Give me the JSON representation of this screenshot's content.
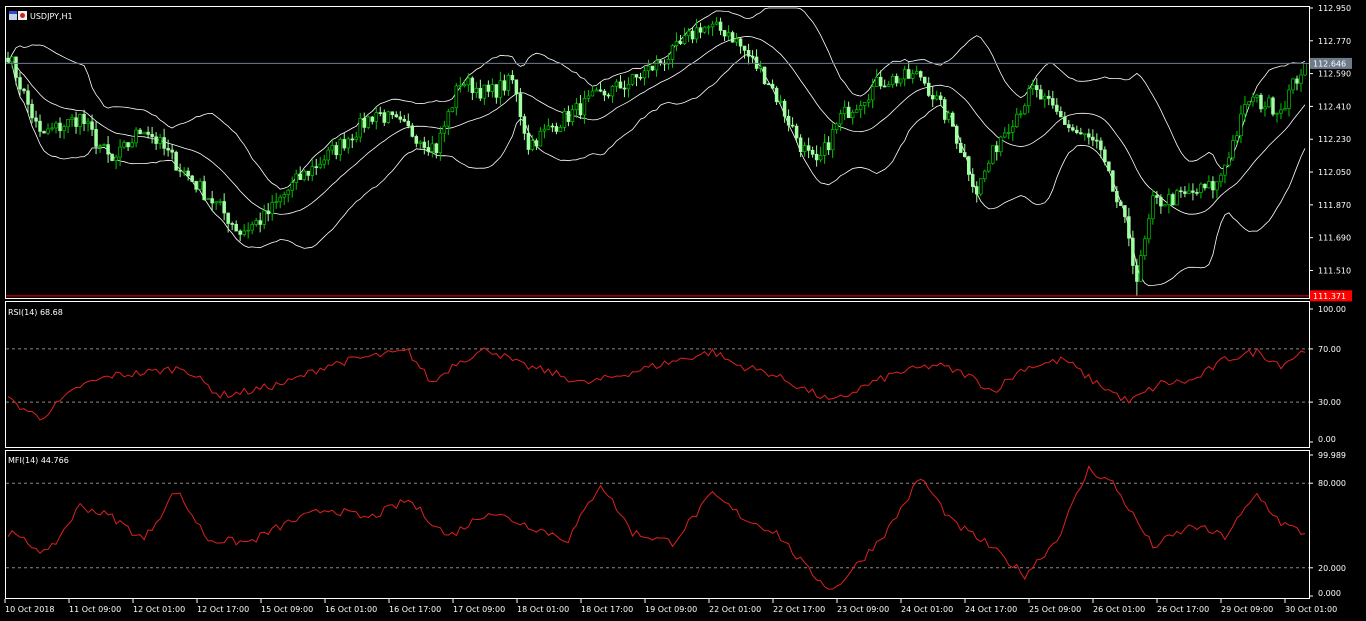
{
  "header": {
    "symbol": "USDJPY,H1",
    "rsi_label": "RSI(14) 68.68",
    "mfi_label": "MFI(14) 44.766"
  },
  "colors": {
    "background": "#000000",
    "frame": "#FFFFFF",
    "bull": "#00C800",
    "bear": "#A0FFA0",
    "bands": "#FFFFFF",
    "indicator": "#FF2020",
    "support_line": "#FF0000",
    "price_tag": "#6E7B8B"
  },
  "chart_data": [
    {
      "type": "candlestick",
      "panel": "main",
      "title": "USDJPY,H1",
      "ylim": [
        111.37,
        112.95
      ],
      "y_ticks": [
        "112.950",
        "112.770",
        "112.590",
        "112.410",
        "112.230",
        "112.050",
        "111.870",
        "111.690",
        "111.510"
      ],
      "last_price": "112.646",
      "support_price": "111.371",
      "overlay": "bollinger",
      "trend_anchors": [
        [
          0,
          112.7
        ],
        [
          8,
          112.25
        ],
        [
          18,
          112.35
        ],
        [
          26,
          112.1
        ],
        [
          34,
          112.3
        ],
        [
          44,
          112.05
        ],
        [
          53,
          111.85
        ],
        [
          58,
          111.72
        ],
        [
          64,
          111.8
        ],
        [
          72,
          112.0
        ],
        [
          82,
          112.18
        ],
        [
          92,
          112.38
        ],
        [
          100,
          112.28
        ],
        [
          107,
          112.18
        ],
        [
          113,
          112.55
        ],
        [
          120,
          112.48
        ],
        [
          126,
          112.55
        ],
        [
          130,
          112.2
        ],
        [
          136,
          112.3
        ],
        [
          146,
          112.45
        ],
        [
          156,
          112.55
        ],
        [
          166,
          112.7
        ],
        [
          173,
          112.85
        ],
        [
          180,
          112.82
        ],
        [
          190,
          112.55
        ],
        [
          198,
          112.2
        ],
        [
          202,
          112.08
        ],
        [
          208,
          112.35
        ],
        [
          218,
          112.55
        ],
        [
          228,
          112.58
        ],
        [
          236,
          112.3
        ],
        [
          242,
          111.95
        ],
        [
          248,
          112.25
        ],
        [
          256,
          112.5
        ],
        [
          266,
          112.28
        ],
        [
          272,
          112.2
        ],
        [
          280,
          111.7
        ],
        [
          282,
          111.45
        ],
        [
          286,
          111.88
        ],
        [
          294,
          111.92
        ],
        [
          302,
          111.98
        ],
        [
          310,
          112.45
        ],
        [
          318,
          112.4
        ],
        [
          324,
          112.65
        ]
      ]
    },
    {
      "type": "line",
      "panel": "rsi",
      "title": "RSI(14) 68.68",
      "ylim": [
        0,
        100
      ],
      "y_ticks": [
        "100.00",
        "70.00",
        "30.00",
        "0.00"
      ],
      "levels": [
        70,
        30
      ],
      "anchors": [
        [
          0,
          32
        ],
        [
          8,
          18
        ],
        [
          18,
          42
        ],
        [
          26,
          50
        ],
        [
          34,
          52
        ],
        [
          44,
          56
        ],
        [
          53,
          35
        ],
        [
          60,
          38
        ],
        [
          70,
          45
        ],
        [
          80,
          58
        ],
        [
          90,
          64
        ],
        [
          100,
          68
        ],
        [
          106,
          44
        ],
        [
          112,
          60
        ],
        [
          120,
          70
        ],
        [
          128,
          58
        ],
        [
          136,
          52
        ],
        [
          144,
          44
        ],
        [
          150,
          48
        ],
        [
          160,
          56
        ],
        [
          168,
          62
        ],
        [
          176,
          68
        ],
        [
          182,
          58
        ],
        [
          190,
          52
        ],
        [
          196,
          44
        ],
        [
          206,
          30
        ],
        [
          214,
          42
        ],
        [
          222,
          52
        ],
        [
          232,
          58
        ],
        [
          240,
          50
        ],
        [
          246,
          38
        ],
        [
          254,
          56
        ],
        [
          264,
          62
        ],
        [
          270,
          48
        ],
        [
          280,
          30
        ],
        [
          288,
          44
        ],
        [
          296,
          46
        ],
        [
          304,
          62
        ],
        [
          312,
          68
        ],
        [
          318,
          58
        ],
        [
          324,
          69
        ]
      ]
    },
    {
      "type": "line",
      "panel": "mfi",
      "title": "MFI(14) 44.766",
      "ylim": [
        0,
        99.989
      ],
      "y_ticks": [
        "99.989",
        "80.000",
        "20.000",
        "0.000"
      ],
      "levels": [
        80,
        20
      ],
      "anchors": [
        [
          0,
          45
        ],
        [
          10,
          30
        ],
        [
          18,
          64
        ],
        [
          26,
          56
        ],
        [
          34,
          40
        ],
        [
          42,
          75
        ],
        [
          50,
          40
        ],
        [
          60,
          38
        ],
        [
          70,
          52
        ],
        [
          80,
          62
        ],
        [
          90,
          55
        ],
        [
          100,
          68
        ],
        [
          110,
          42
        ],
        [
          120,
          60
        ],
        [
          130,
          50
        ],
        [
          140,
          40
        ],
        [
          148,
          80
        ],
        [
          156,
          45
        ],
        [
          166,
          38
        ],
        [
          176,
          72
        ],
        [
          184,
          55
        ],
        [
          192,
          45
        ],
        [
          200,
          18
        ],
        [
          206,
          4
        ],
        [
          214,
          28
        ],
        [
          220,
          48
        ],
        [
          228,
          84
        ],
        [
          236,
          52
        ],
        [
          244,
          38
        ],
        [
          254,
          15
        ],
        [
          262,
          40
        ],
        [
          270,
          90
        ],
        [
          276,
          80
        ],
        [
          286,
          35
        ],
        [
          296,
          50
        ],
        [
          304,
          42
        ],
        [
          312,
          72
        ],
        [
          318,
          52
        ],
        [
          324,
          44
        ]
      ]
    }
  ],
  "x_axis": {
    "labels": [
      "10 Oct 2018",
      "11 Oct 09:00",
      "12 Oct 01:00",
      "12 Oct 17:00",
      "15 Oct 09:00",
      "16 Oct 01:00",
      "16 Oct 17:00",
      "17 Oct 09:00",
      "18 Oct 01:00",
      "18 Oct 17:00",
      "19 Oct 09:00",
      "22 Oct 01:00",
      "22 Oct 17:00",
      "23 Oct 09:00",
      "24 Oct 01:00",
      "24 Oct 17:00",
      "25 Oct 09:00",
      "26 Oct 01:00",
      "26 Oct 17:00",
      "29 Oct 09:00",
      "30 Oct 01:00"
    ]
  }
}
